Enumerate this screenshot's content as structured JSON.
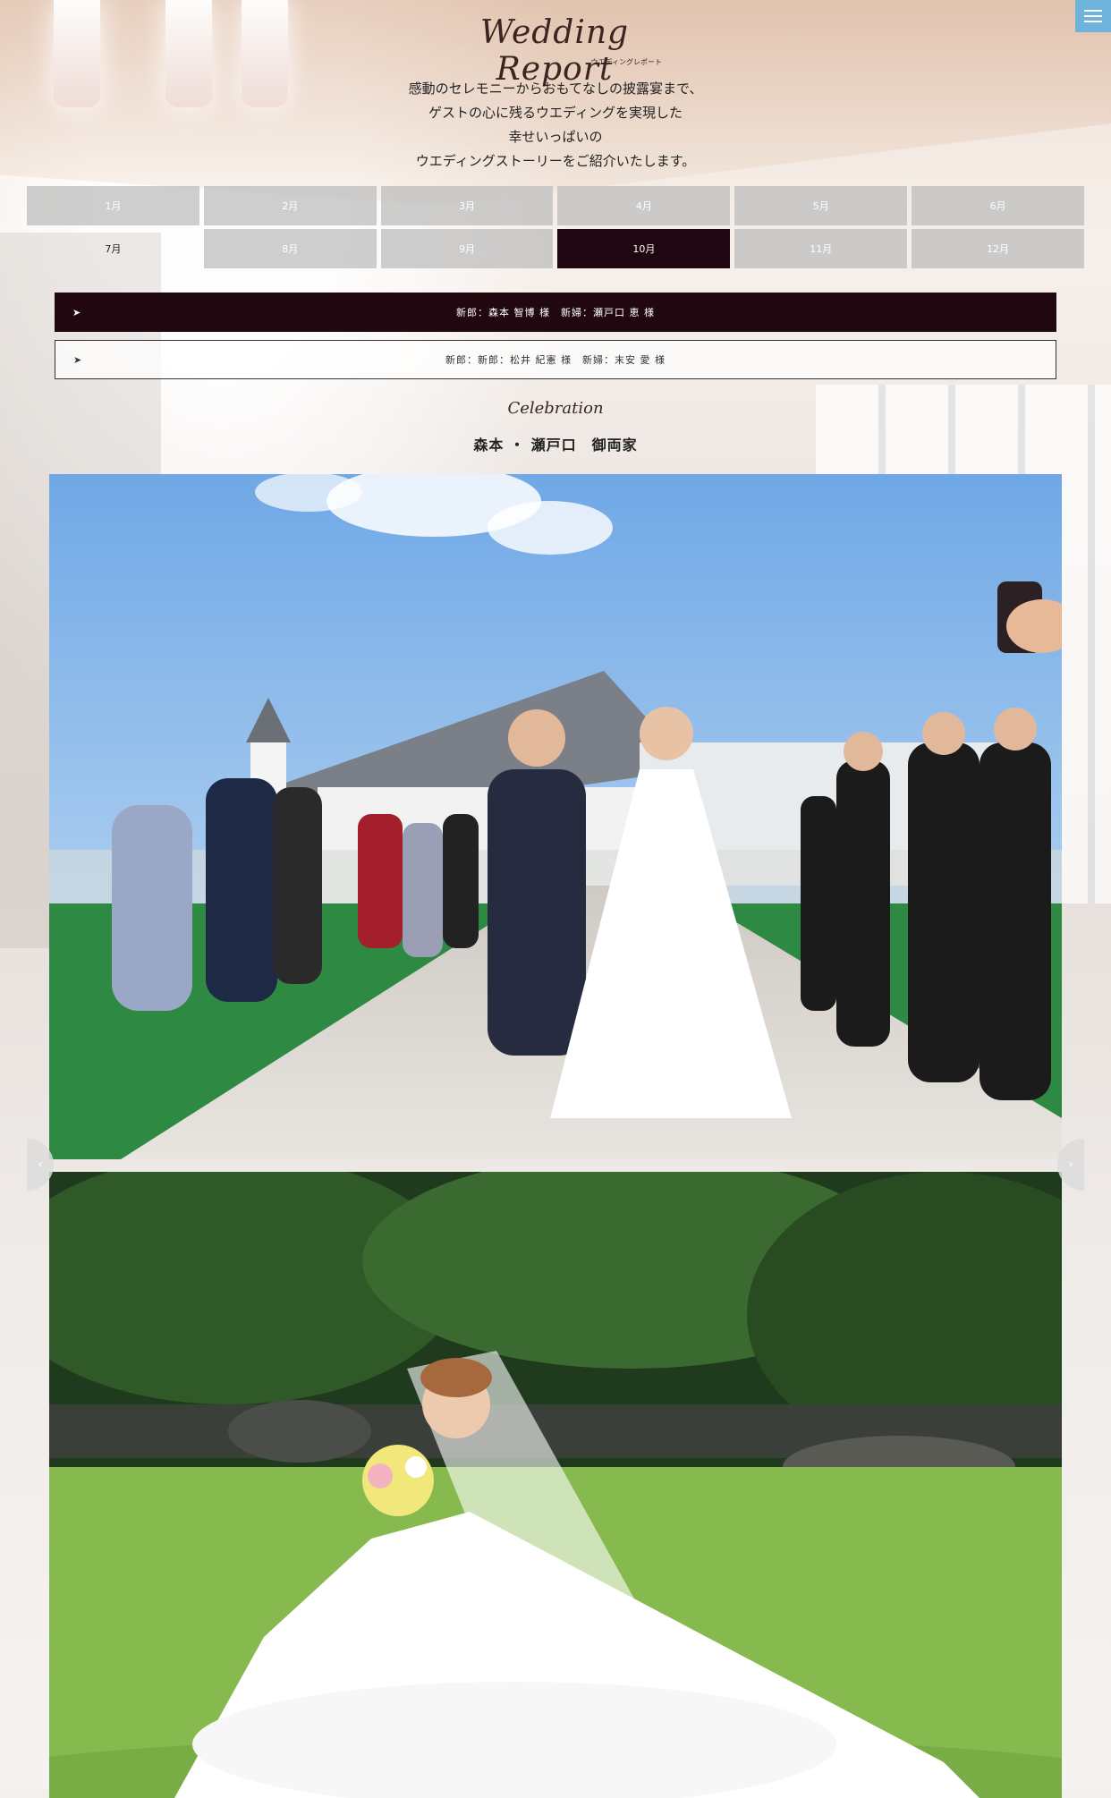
{
  "header": {
    "logo_script": "Wedding Report",
    "logo_kana": "ウエディングレポート",
    "menu_icon": "hamburger-menu-icon"
  },
  "intro": {
    "lines": [
      "感動のセレモニーからおもてなしの披露宴まで、",
      "ゲストの心に残るウエディングを実現した",
      "幸せいっぱいの",
      "ウエディングストーリーをご紹介いたします。"
    ]
  },
  "months": {
    "items": [
      "1月",
      "2月",
      "3月",
      "4月",
      "5月",
      "6月",
      "7月",
      "8月",
      "9月",
      "10月",
      "11月",
      "12月"
    ],
    "selected": "10月"
  },
  "couples": [
    {
      "arrow": "➤",
      "label": "新郎：森本 智博 様　新婦：瀬戸口 恵 様"
    },
    {
      "arrow": "➤",
      "label": "新郎：新郎：松井 紀憲 様　新婦：末安 愛 様"
    }
  ],
  "report": {
    "script_heading": "Celebration",
    "family_title": "森本 ・ 瀬戸口　御両家"
  },
  "slider": {
    "prev_glyph": "‹",
    "next_glyph": "›"
  },
  "colors": {
    "accent_dark": "#1f0610",
    "menu_button": "#6eb3d9",
    "month_bg": "#bebebe"
  }
}
